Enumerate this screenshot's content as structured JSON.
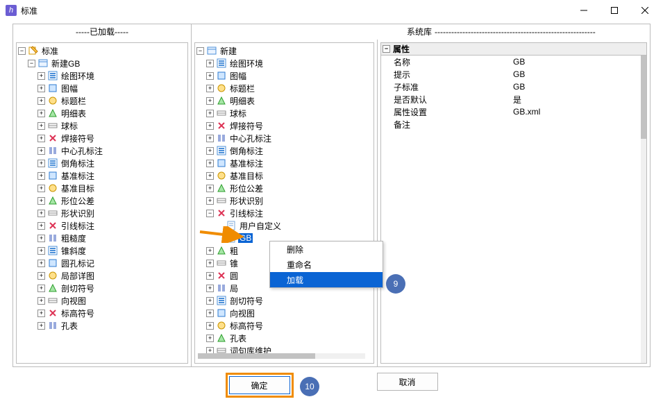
{
  "window": {
    "title": "标准"
  },
  "headers": {
    "loaded": "-----已加载-----",
    "system": "系统库",
    "system_dashes": "----------------------------------------------------------"
  },
  "left_tree": {
    "root": "标准",
    "child": "新建GB",
    "items": [
      "绘图环境",
      "图幅",
      "标题栏",
      "明细表",
      "球标",
      "焊接符号",
      "中心孔标注",
      "倒角标注",
      "基准标注",
      "基准目标",
      "形位公差",
      "形状识别",
      "引线标注",
      "粗糙度",
      "锥斜度",
      "圆孔标记",
      "局部详图",
      "剖切符号",
      "向视图",
      "标高符号",
      "孔表"
    ]
  },
  "mid_tree": {
    "root": "新建",
    "items": [
      "绘图环境",
      "图幅",
      "标题栏",
      "明细表",
      "球标",
      "焊接符号",
      "中心孔标注",
      "倒角标注",
      "基准标注",
      "基准目标",
      "形位公差",
      "形状识别",
      "引线标注"
    ],
    "leader_children": {
      "first": "用户自定义",
      "second": "GB"
    },
    "items_after": [
      "粗糙度",
      "锥斜度",
      "圆孔标记",
      "局部详图",
      "剖切符号",
      "向视图",
      "标高符号",
      "孔表",
      "词句库维护"
    ]
  },
  "context_menu": {
    "delete": "删除",
    "rename": "重命名",
    "load": "加载"
  },
  "props": {
    "header": "属性",
    "rows": [
      {
        "k": "名称",
        "v": "GB"
      },
      {
        "k": "提示",
        "v": "GB"
      },
      {
        "k": "子标准",
        "v": "GB"
      },
      {
        "k": "是否默认",
        "v": "是"
      },
      {
        "k": "属性设置",
        "v": "GB.xml"
      },
      {
        "k": "备注",
        "v": ""
      }
    ]
  },
  "buttons": {
    "ok": "确定",
    "cancel": "取消"
  },
  "badges": {
    "nine": "9",
    "ten": "10"
  }
}
